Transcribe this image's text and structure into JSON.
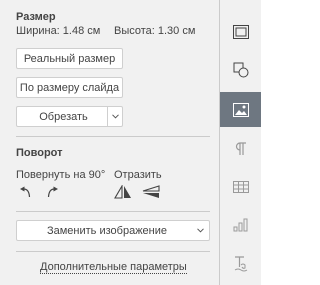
{
  "size": {
    "title": "Размер",
    "width_label": "Ширина: 1.48 см",
    "height_label": "Высота: 1.30 см",
    "actual_size_button": "Реальный размер",
    "fit_slide_button": "По размеру слайда",
    "crop_button": "Обрезать"
  },
  "rotation": {
    "title": "Поворот",
    "rotate_label": "Повернуть на 90°",
    "flip_label": "Отразить"
  },
  "replace_image_button": "Заменить изображение",
  "advanced_settings_link": "Дополнительные параметры",
  "sidebar": {
    "items": [
      {
        "name": "slide-settings",
        "icon": "slide-icon"
      },
      {
        "name": "shape-settings",
        "icon": "shape-icon"
      },
      {
        "name": "image-settings",
        "icon": "image-icon",
        "active": true
      },
      {
        "name": "paragraph-settings",
        "icon": "paragraph-icon"
      },
      {
        "name": "table-settings",
        "icon": "table-icon"
      },
      {
        "name": "chart-settings",
        "icon": "chart-icon"
      },
      {
        "name": "textart-settings",
        "icon": "textart-icon"
      }
    ]
  },
  "colors": {
    "active_sidebar": "#6e7781",
    "panel_bg": "#f1f1f1"
  }
}
